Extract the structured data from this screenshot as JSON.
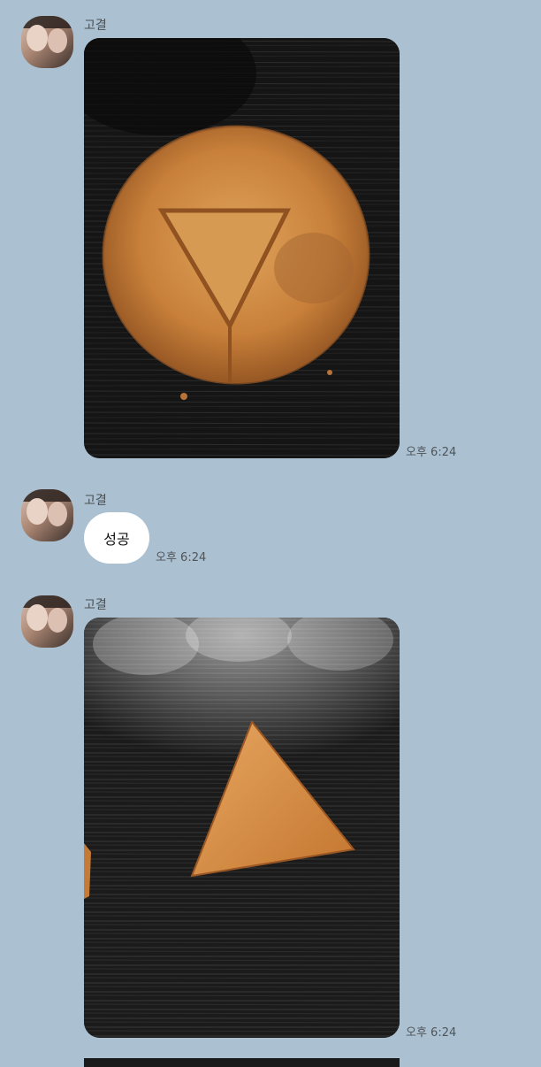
{
  "messages": [
    {
      "sender": "고결",
      "type": "photo",
      "photo_desc": "dalgona-circle-triangle",
      "time": "오후 6:24"
    },
    {
      "sender": "고결",
      "type": "text",
      "text": "성공",
      "time": "오후 6:24"
    },
    {
      "sender": "고결",
      "type": "photo",
      "photo_desc": "dalgona-triangle-cutout",
      "time": "오후 6:24"
    }
  ],
  "colors": {
    "background": "#abc1d1",
    "bubble": "#ffffff",
    "candy": "#c9823a"
  }
}
